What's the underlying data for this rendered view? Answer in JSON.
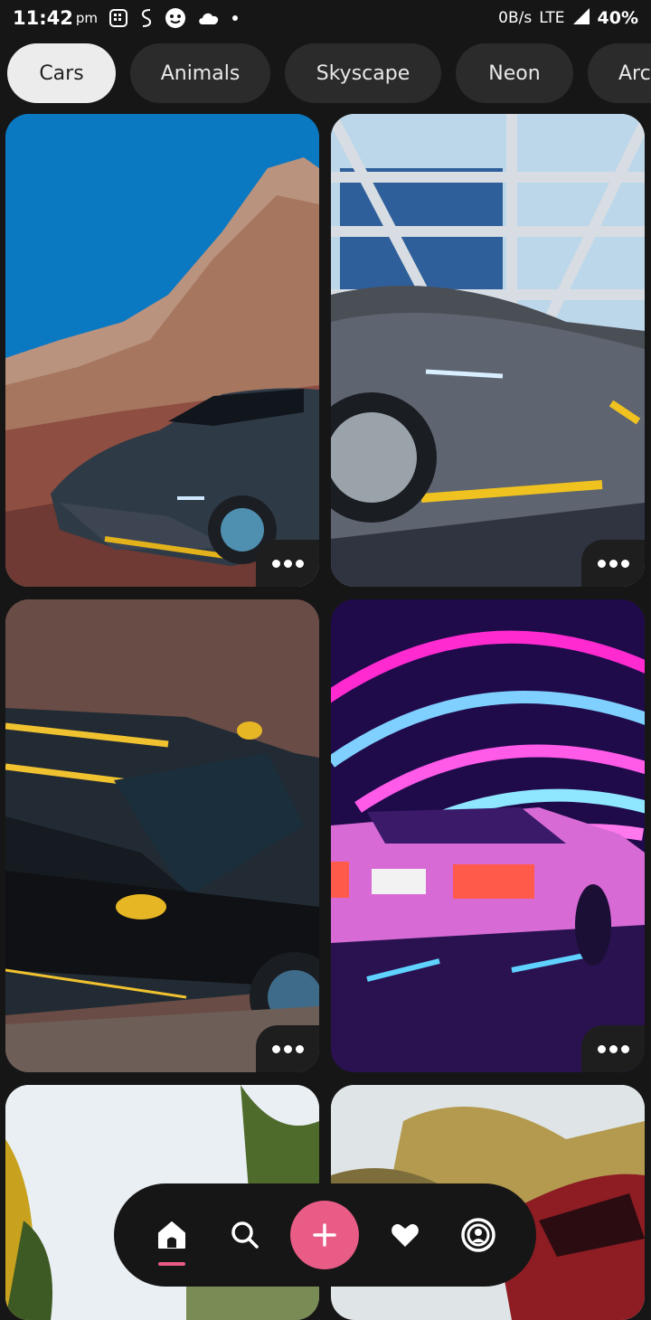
{
  "status_bar": {
    "time": "11:42",
    "ampm": "pm",
    "network_speed": "0B/s",
    "network_type": "LTE",
    "battery": "40%"
  },
  "categories": [
    {
      "label": "Cars",
      "active": true
    },
    {
      "label": "Animals",
      "active": false
    },
    {
      "label": "Skyscape",
      "active": false
    },
    {
      "label": "Neon",
      "active": false
    },
    {
      "label": "Arc",
      "active": false
    }
  ],
  "wallpapers": [
    {
      "subject": "Grey sports car on red desert rocks"
    },
    {
      "subject": "Grey sports car under steel structure"
    },
    {
      "subject": "Black sports car with yellow stripes, top view"
    },
    {
      "subject": "Neon pink retro car in tunnel"
    },
    {
      "subject": "Trees under cloudy sky"
    },
    {
      "subject": "Red car in autumn forest"
    }
  ],
  "nav": {
    "items": [
      "home-icon",
      "search-icon",
      "add-icon",
      "heart-icon",
      "profile-icon"
    ],
    "active": "home",
    "accent_color": "#e85c86"
  }
}
